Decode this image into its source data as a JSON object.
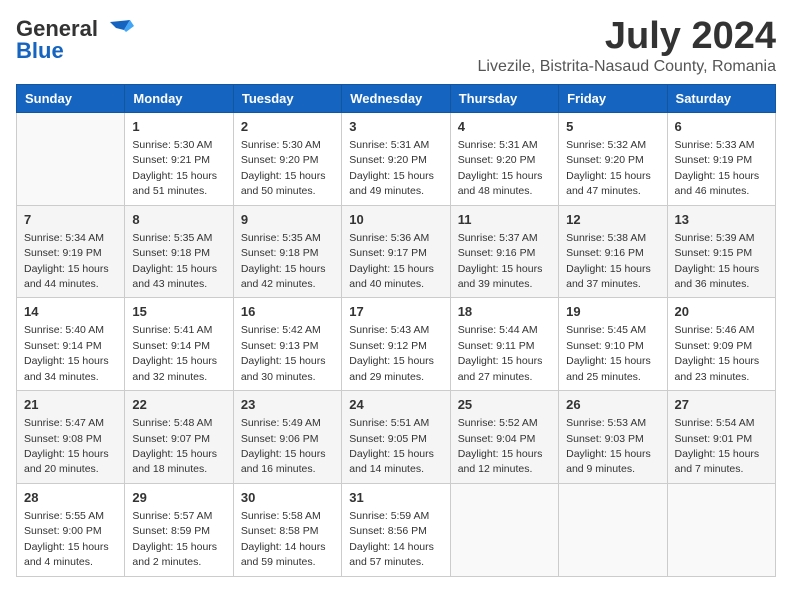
{
  "header": {
    "logo_general": "General",
    "logo_blue": "Blue",
    "title": "July 2024",
    "subtitle": "Livezile, Bistrita-Nasaud County, Romania"
  },
  "days_of_week": [
    "Sunday",
    "Monday",
    "Tuesday",
    "Wednesday",
    "Thursday",
    "Friday",
    "Saturday"
  ],
  "weeks": [
    [
      {
        "day": "",
        "empty": true
      },
      {
        "day": "1",
        "sunrise": "5:30 AM",
        "sunset": "9:21 PM",
        "daylight": "15 hours and 51 minutes."
      },
      {
        "day": "2",
        "sunrise": "5:30 AM",
        "sunset": "9:20 PM",
        "daylight": "15 hours and 50 minutes."
      },
      {
        "day": "3",
        "sunrise": "5:31 AM",
        "sunset": "9:20 PM",
        "daylight": "15 hours and 49 minutes."
      },
      {
        "day": "4",
        "sunrise": "5:31 AM",
        "sunset": "9:20 PM",
        "daylight": "15 hours and 48 minutes."
      },
      {
        "day": "5",
        "sunrise": "5:32 AM",
        "sunset": "9:20 PM",
        "daylight": "15 hours and 47 minutes."
      },
      {
        "day": "6",
        "sunrise": "5:33 AM",
        "sunset": "9:19 PM",
        "daylight": "15 hours and 46 minutes."
      }
    ],
    [
      {
        "day": "7",
        "sunrise": "5:34 AM",
        "sunset": "9:19 PM",
        "daylight": "15 hours and 44 minutes."
      },
      {
        "day": "8",
        "sunrise": "5:35 AM",
        "sunset": "9:18 PM",
        "daylight": "15 hours and 43 minutes."
      },
      {
        "day": "9",
        "sunrise": "5:35 AM",
        "sunset": "9:18 PM",
        "daylight": "15 hours and 42 minutes."
      },
      {
        "day": "10",
        "sunrise": "5:36 AM",
        "sunset": "9:17 PM",
        "daylight": "15 hours and 40 minutes."
      },
      {
        "day": "11",
        "sunrise": "5:37 AM",
        "sunset": "9:16 PM",
        "daylight": "15 hours and 39 minutes."
      },
      {
        "day": "12",
        "sunrise": "5:38 AM",
        "sunset": "9:16 PM",
        "daylight": "15 hours and 37 minutes."
      },
      {
        "day": "13",
        "sunrise": "5:39 AM",
        "sunset": "9:15 PM",
        "daylight": "15 hours and 36 minutes."
      }
    ],
    [
      {
        "day": "14",
        "sunrise": "5:40 AM",
        "sunset": "9:14 PM",
        "daylight": "15 hours and 34 minutes."
      },
      {
        "day": "15",
        "sunrise": "5:41 AM",
        "sunset": "9:14 PM",
        "daylight": "15 hours and 32 minutes."
      },
      {
        "day": "16",
        "sunrise": "5:42 AM",
        "sunset": "9:13 PM",
        "daylight": "15 hours and 30 minutes."
      },
      {
        "day": "17",
        "sunrise": "5:43 AM",
        "sunset": "9:12 PM",
        "daylight": "15 hours and 29 minutes."
      },
      {
        "day": "18",
        "sunrise": "5:44 AM",
        "sunset": "9:11 PM",
        "daylight": "15 hours and 27 minutes."
      },
      {
        "day": "19",
        "sunrise": "5:45 AM",
        "sunset": "9:10 PM",
        "daylight": "15 hours and 25 minutes."
      },
      {
        "day": "20",
        "sunrise": "5:46 AM",
        "sunset": "9:09 PM",
        "daylight": "15 hours and 23 minutes."
      }
    ],
    [
      {
        "day": "21",
        "sunrise": "5:47 AM",
        "sunset": "9:08 PM",
        "daylight": "15 hours and 20 minutes."
      },
      {
        "day": "22",
        "sunrise": "5:48 AM",
        "sunset": "9:07 PM",
        "daylight": "15 hours and 18 minutes."
      },
      {
        "day": "23",
        "sunrise": "5:49 AM",
        "sunset": "9:06 PM",
        "daylight": "15 hours and 16 minutes."
      },
      {
        "day": "24",
        "sunrise": "5:51 AM",
        "sunset": "9:05 PM",
        "daylight": "15 hours and 14 minutes."
      },
      {
        "day": "25",
        "sunrise": "5:52 AM",
        "sunset": "9:04 PM",
        "daylight": "15 hours and 12 minutes."
      },
      {
        "day": "26",
        "sunrise": "5:53 AM",
        "sunset": "9:03 PM",
        "daylight": "15 hours and 9 minutes."
      },
      {
        "day": "27",
        "sunrise": "5:54 AM",
        "sunset": "9:01 PM",
        "daylight": "15 hours and 7 minutes."
      }
    ],
    [
      {
        "day": "28",
        "sunrise": "5:55 AM",
        "sunset": "9:00 PM",
        "daylight": "15 hours and 4 minutes."
      },
      {
        "day": "29",
        "sunrise": "5:57 AM",
        "sunset": "8:59 PM",
        "daylight": "15 hours and 2 minutes."
      },
      {
        "day": "30",
        "sunrise": "5:58 AM",
        "sunset": "8:58 PM",
        "daylight": "14 hours and 59 minutes."
      },
      {
        "day": "31",
        "sunrise": "5:59 AM",
        "sunset": "8:56 PM",
        "daylight": "14 hours and 57 minutes."
      },
      {
        "day": "",
        "empty": true
      },
      {
        "day": "",
        "empty": true
      },
      {
        "day": "",
        "empty": true
      }
    ]
  ],
  "labels": {
    "sunrise": "Sunrise:",
    "sunset": "Sunset:",
    "daylight": "Daylight:"
  }
}
